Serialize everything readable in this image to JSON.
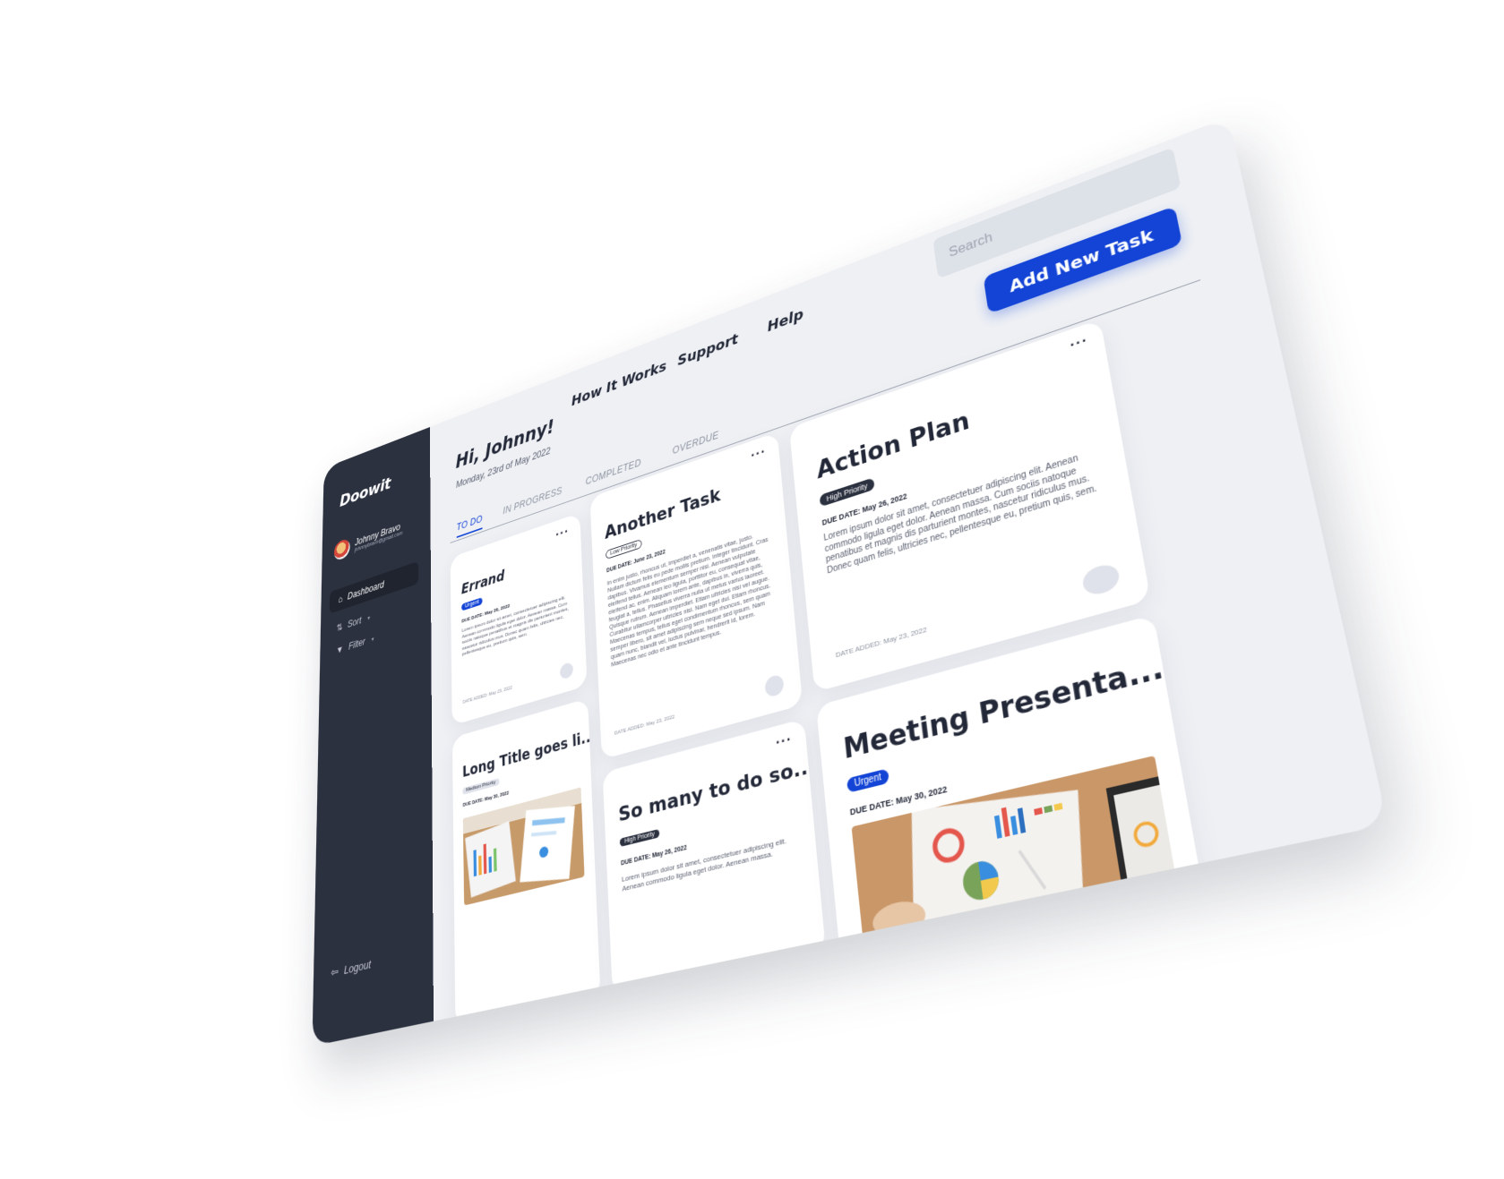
{
  "sidebar": {
    "logo": "Doowit",
    "user_name": "Johnny Bravo",
    "user_email": "johnnybravo@gmail.com",
    "nav_dashboard": "Dashboard",
    "nav_sort": "Sort",
    "nav_filter": "Filter",
    "logout": "Logout"
  },
  "header": {
    "greeting": "Hi, Johnny!",
    "date": "Monday, 23rd of May 2022",
    "nav": [
      "How It Works",
      "Support",
      "Help"
    ],
    "search_placeholder": "Search",
    "add_button": "Add New Task"
  },
  "tabs": [
    "TO DO",
    "IN PROGRESS",
    "COMPLETED",
    "OVERDUE"
  ],
  "cards": {
    "errand": {
      "title": "Errand",
      "tag": "Urgent",
      "due": "DUE DATE: May 26, 2022",
      "body": "Lorem ipsum dolor sit amet, consectetuer adipiscing elit. Aenean commodo ligula eget dolor. Aenean massa. Cum sociis natoque penatibus et magnis dis parturient montes, nascetur ridiculus mus. Donec quam felis, ultricies nec, pellentesque eu, pretium quis, sem.",
      "added": "DATE ADDED: May 23, 2022"
    },
    "another": {
      "title": "Another Task",
      "tag": "Low Priority",
      "due": "DUE DATE: June 23, 2022",
      "body": "In enim justo, rhoncus ut, imperdiet a, venenatis vitae, justo. Nullam dictum felis eu pede mollis pretium. Integer tincidunt. Cras dapibus. Vivamus elementum semper nisi. Aenean vulputate eleifend tellus. Aenean leo ligula, porttitor eu, consequat vitae, eleifend ac, enim. Aliquam lorem ante, dapibus in, viverra quis, feugiat a, tellus. Phasellus viverra nulla ut metus varius laoreet. Quisque rutrum. Aenean imperdiet. Etiam ultricies nisi vel augue. Curabitur ullamcorper ultricies nisi. Nam eget dui. Etiam rhoncus. Maecenas tempus, tellus eget condimentum rhoncus, sem quam semper libero, sit amet adipiscing sem neque sed ipsum. Nam quam nunc, blandit vel, luctus pulvinar, hendrerit id, lorem. Maecenas nec odio et ante tincidunt tempus.",
      "added": "DATE ADDED: May 23, 2022"
    },
    "action": {
      "title": "Action Plan",
      "tag": "High Priority",
      "due": "DUE DATE: May 26, 2022",
      "body": "Lorem ipsum dolor sit amet, consectetuer adipiscing elit. Aenean commodo ligula eget dolor. Aenean massa. Cum sociis natoque penatibus et magnis dis parturient montes, nascetur ridiculus mus. Donec quam felis, ultricies nec, pellentesque eu, pretium quis, sem.",
      "added": "DATE ADDED: May 23, 2022"
    },
    "long": {
      "title": "Long Title goes li...",
      "tag": "Medium Priority",
      "due": "DUE DATE: May 30, 2022"
    },
    "somany": {
      "title": "So many to do so...",
      "tag": "High Priority",
      "due": "DUE DATE: May 26, 2022",
      "body": "Lorem ipsum dolor sit amet, consectetuer adipiscing elit. Aenean commodo ligula eget dolor. Aenean massa."
    },
    "meeting": {
      "title": "Meeting Presenta...",
      "tag": "Urgent",
      "due": "DUE DATE: May 30, 2022"
    }
  },
  "icons": {
    "home": "home-icon",
    "sort": "sort-icon",
    "filter": "filter-icon",
    "logout": "logout-icon",
    "more": "more-icon"
  },
  "colors": {
    "accent": "#1344d6",
    "sidebar": "#2c3140",
    "background": "#eef0f4"
  }
}
